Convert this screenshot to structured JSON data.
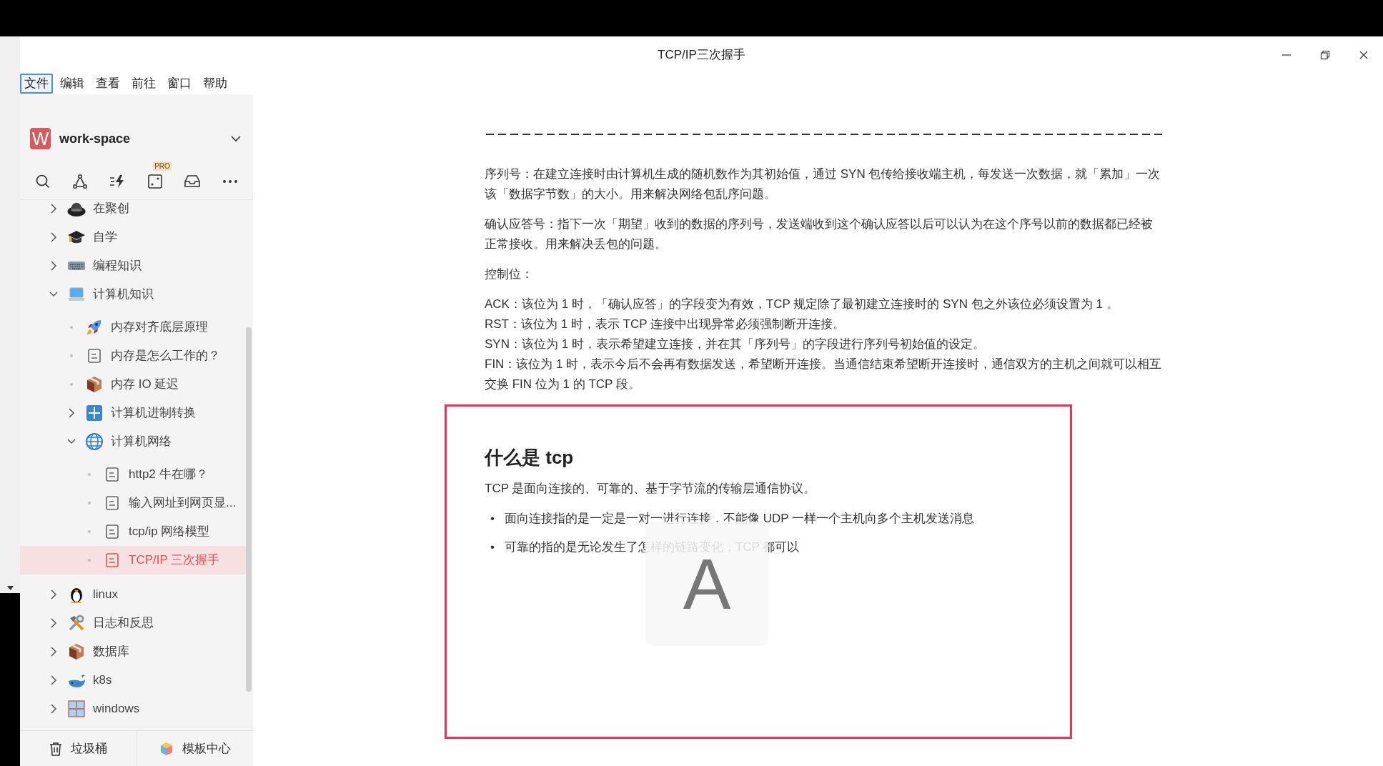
{
  "window": {
    "title": "TCP/IP三次握手"
  },
  "menu": [
    {
      "label": "文件",
      "selected": true
    },
    {
      "label": "编辑",
      "selected": false
    },
    {
      "label": "查看",
      "selected": false
    },
    {
      "label": "前往",
      "selected": false
    },
    {
      "label": "窗口",
      "selected": false
    },
    {
      "label": "帮助",
      "selected": false
    }
  ],
  "workspace": {
    "logo": "W",
    "name": "work-space",
    "pro_badge": "PRO"
  },
  "tree": [
    {
      "label": "在聚创",
      "expanded": false,
      "selected": false
    },
    {
      "label": "自学",
      "expanded": false,
      "selected": false
    },
    {
      "label": "编程知识",
      "expanded": false,
      "selected": false
    },
    {
      "label": "计算机知识",
      "expanded": true,
      "selected": false,
      "children": [
        {
          "label": "内存对齐底层原理",
          "selected": false
        },
        {
          "label": "内存是怎么工作的？",
          "selected": false
        },
        {
          "label": "内存 IO 延迟",
          "selected": false
        },
        {
          "label": "计算机进制转换",
          "expanded": false,
          "selected": false
        },
        {
          "label": "计算机网络",
          "expanded": true,
          "selected": false,
          "children": [
            {
              "label": "http2 牛在哪？",
              "selected": false
            },
            {
              "label": "输入网址到网页显...",
              "selected": false
            },
            {
              "label": "tcp/ip 网络模型",
              "selected": false
            },
            {
              "label": "TCP/IP 三次握手",
              "selected": true
            }
          ]
        }
      ]
    },
    {
      "label": "linux",
      "expanded": false,
      "selected": false
    },
    {
      "label": "日志和反思",
      "expanded": false,
      "selected": false
    },
    {
      "label": "数据库",
      "expanded": false,
      "selected": false
    },
    {
      "label": "k8s",
      "expanded": false,
      "selected": false
    },
    {
      "label": "windows",
      "expanded": false,
      "selected": false
    }
  ],
  "footer": [
    "垃圾桶",
    "模板中心"
  ],
  "content": [
    {
      "kind": "divider"
    },
    {
      "kind": "paragraph",
      "text": "序列号：在建立连接时由计算机生成的随机数作为其初始值，通过 SYN 包传给接收端主机，每发送一次数据，就「累加」一次该「数据字节数」的大小。用来解决网络包乱序问题。"
    },
    {
      "kind": "paragraph",
      "text": "确认应答号：指下一次「期望」收到的数据的序列号，发送端收到这个确认应答以后可以认为在这个序号以前的数据都已经被正常接收。用来解决丢包的问题。"
    },
    {
      "kind": "paragraph",
      "text": "控制位："
    },
    {
      "kind": "lines",
      "lines": [
        "ACK：该位为 1 时，「确认应答」的字段变为有效，TCP 规定除了最初建立连接时的 SYN 包之外该位必须设置为 1 。",
        "RST：该位为 1 时，表示 TCP 连接中出现异常必须强制断开连接。",
        "SYN：该位为 1 时，表示希望建立连接，并在其「序列号」的字段进行序列号初始值的设定。",
        "FIN：该位为 1 时，表示今后不会再有数据发送，希望断开连接。当通信结束希望断开连接时，通信双方的主机之间就可以相互交换 FIN 位为 1 的 TCP 段。"
      ]
    },
    {
      "kind": "highlight",
      "blocks": [
        {
          "kind": "heading",
          "text": "什么是 tcp"
        },
        {
          "kind": "paragraph",
          "text": "TCP 是面向连接的、可靠的、基于字节流的传输层通信协议。"
        },
        {
          "kind": "bullets",
          "marker": "•",
          "items": [
            "面向连接指的是一定是一对一进行连接，不能像 UDP 一样一个主机向多个主机发送消息",
            "可靠的指的是无论发生了怎样的链路变化，TCP 都可以"
          ]
        }
      ]
    }
  ],
  "input_indicator": {
    "letter": "A"
  }
}
